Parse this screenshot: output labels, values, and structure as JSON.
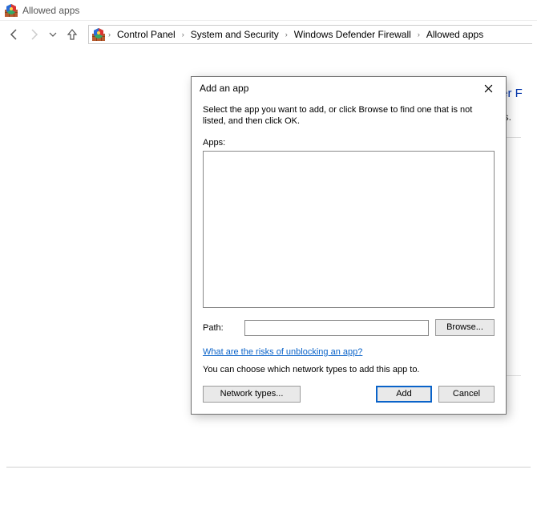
{
  "window": {
    "title": "Allowed apps"
  },
  "breadcrumb": {
    "items": [
      "Control Panel",
      "System and Security",
      "Windows Defender Firewall",
      "Allowed apps"
    ]
  },
  "main": {
    "heading": "Allow apps to communicate through Windows Defender F",
    "sub_fragment": "tings."
  },
  "dialog": {
    "title": "Add an app",
    "instruction": "Select the app you want to add, or click Browse to find one that is not listed, and then click OK.",
    "apps_label": "Apps:",
    "path_label": "Path:",
    "path_value": "",
    "browse_btn": "Browse...",
    "risks_link": "What are the risks of unblocking an app?",
    "choose_note": "You can choose which network types to add this app to.",
    "network_types_btn": "Network types...",
    "add_btn": "Add",
    "cancel_btn": "Cancel"
  }
}
